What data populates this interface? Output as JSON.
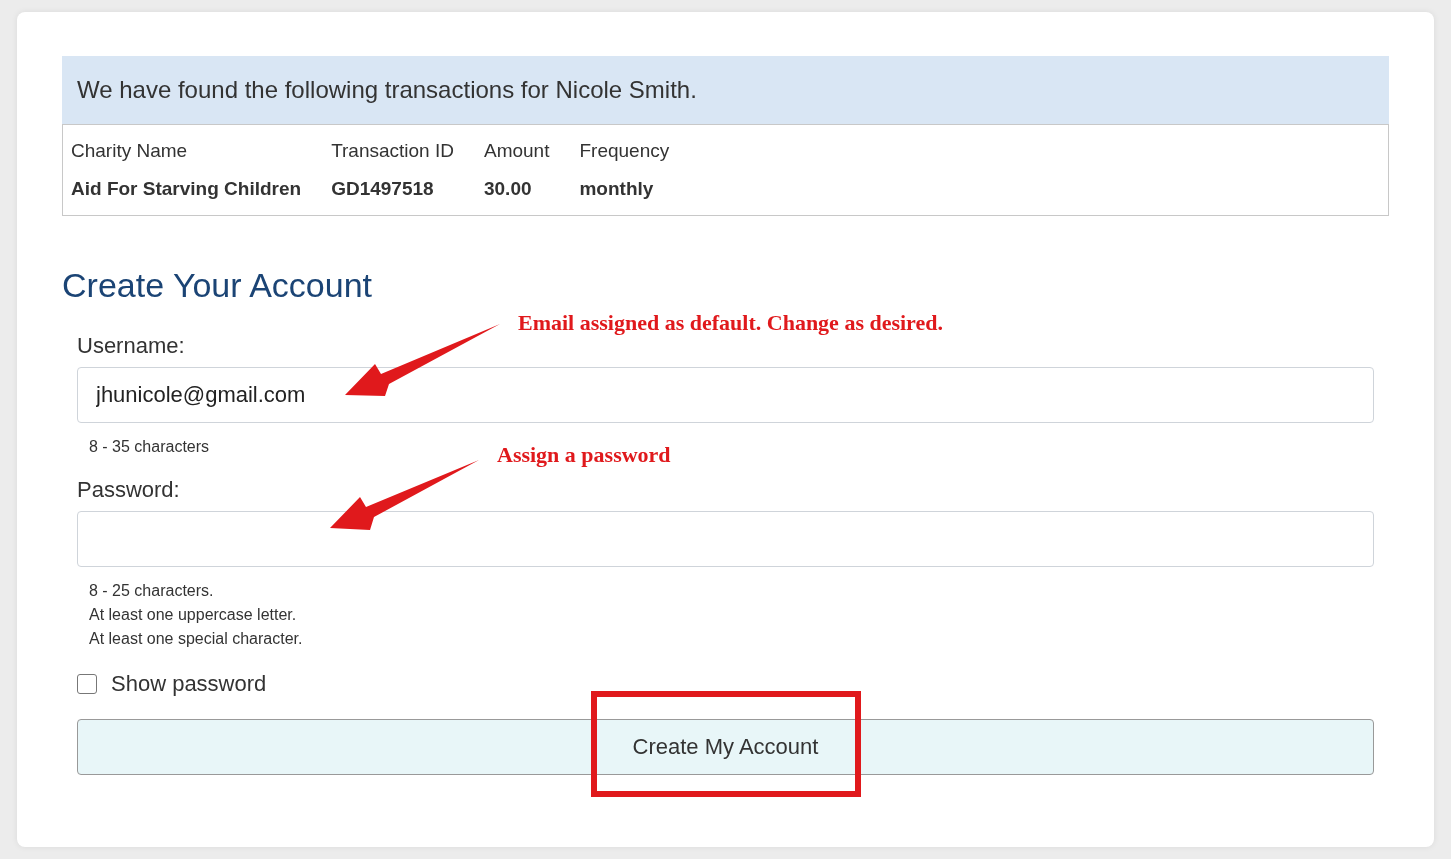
{
  "banner": {
    "text": "We have found the following transactions for Nicole Smith."
  },
  "transactions": {
    "columns": [
      "Charity Name",
      "Transaction ID",
      "Amount",
      "Frequency"
    ],
    "rows": [
      [
        "Aid For Starving Children",
        "GD1497518",
        "30.00",
        "monthly"
      ]
    ]
  },
  "heading": "Create Your Account",
  "fields": [
    {
      "label": "Username:",
      "value": "jhunicole@gmail.com",
      "hints": [
        "8 - 35 characters"
      ]
    },
    {
      "label": "Password:",
      "hints": [
        "8 - 25 characters.",
        "At least one uppercase letter.",
        "At least one special character."
      ]
    }
  ],
  "show_password": {
    "label": "Show password",
    "checked": false
  },
  "submit": {
    "label": "Create My Account"
  },
  "annotations": [
    {
      "kind": "callout",
      "text": "Email assigned as default. Change as desired."
    },
    {
      "kind": "callout",
      "text": "Assign a password"
    },
    {
      "kind": "highlight"
    }
  ]
}
